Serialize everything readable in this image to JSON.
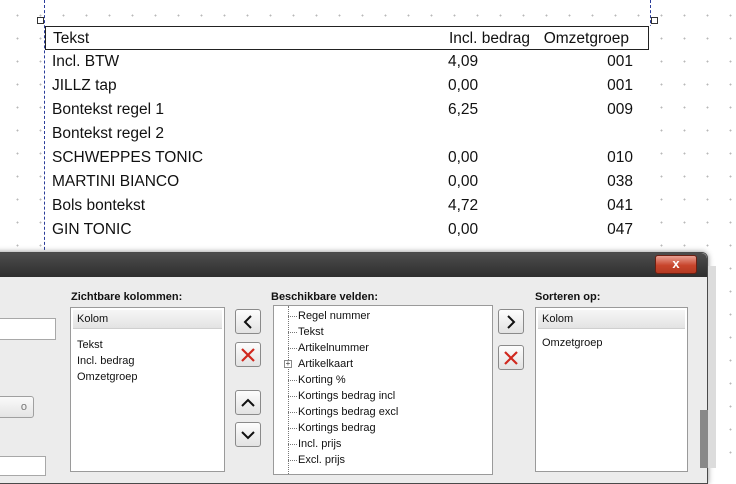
{
  "report": {
    "headers": {
      "tekst": "Tekst",
      "incl": "Incl. bedrag",
      "groep": "Omzetgroep"
    },
    "rows": [
      {
        "tekst": "Incl. BTW",
        "incl": "4,09",
        "groep": "001"
      },
      {
        "tekst": "JILLZ tap",
        "incl": "0,00",
        "groep": "001"
      },
      {
        "tekst": "Bontekst regel 1",
        "incl": "6,25",
        "groep": "009"
      },
      {
        "tekst": "Bontekst regel 2",
        "incl": "",
        "groep": ""
      },
      {
        "tekst": "SCHWEPPES TONIC",
        "incl": "0,00",
        "groep": "010"
      },
      {
        "tekst": "MARTINI BIANCO",
        "incl": "0,00",
        "groep": "038"
      },
      {
        "tekst": "Bols bontekst",
        "incl": "4,72",
        "groep": "041"
      },
      {
        "tekst": "GIN TONIC",
        "incl": "0,00",
        "groep": "047"
      }
    ]
  },
  "dialog": {
    "close_label": "x",
    "left_button_text": "o",
    "visible_columns": {
      "label": "Zichtbare kolommen:",
      "header": "Kolom",
      "items": [
        "Tekst",
        "Incl. bedrag",
        "Omzetgroep"
      ]
    },
    "available_fields": {
      "label": "Beschikbare velden:",
      "items": [
        "Regel nummer",
        "Tekst",
        "Artikelnummer",
        "Artikelkaart",
        "Korting %",
        "Kortings bedrag incl",
        "Kortings bedrag excl",
        "Kortings bedrag",
        "Incl. prijs",
        "Excl. prijs"
      ],
      "expandable_item_index": 3
    },
    "sort_on": {
      "label": "Sorteren op:",
      "header": "Kolom",
      "items": [
        "Omzetgroep"
      ]
    }
  },
  "colors": {
    "delete_icon": "#d0281e",
    "titlebar": "#3a3a3a",
    "close_button": "#c8452c"
  }
}
